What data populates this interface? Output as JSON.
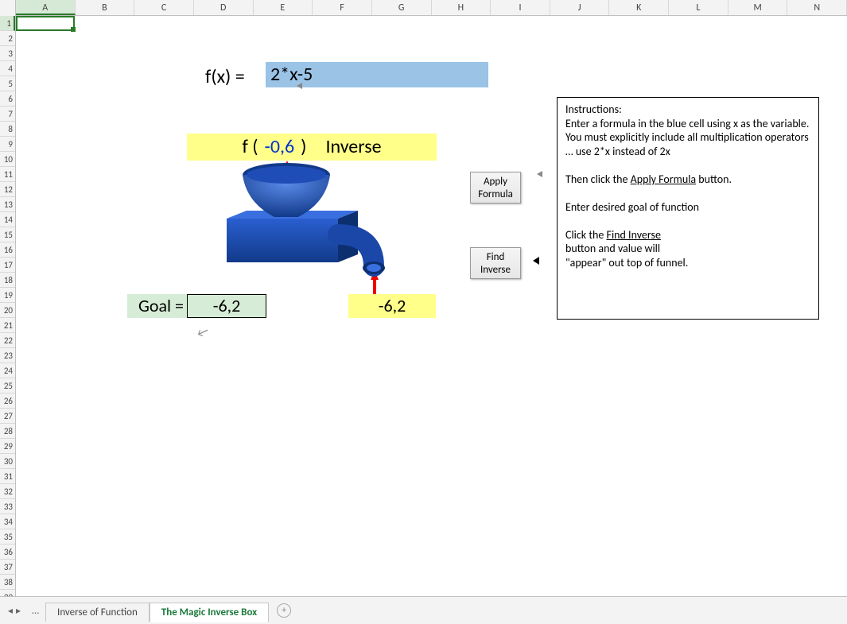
{
  "columns": [
    "A",
    "B",
    "C",
    "D",
    "E",
    "F",
    "G",
    "H",
    "I",
    "J",
    "K",
    "L",
    "M",
    "N"
  ],
  "selected_column_index": 0,
  "selected_row_index": 0,
  "fx": {
    "label": "f(x)  =",
    "formula": "2*x-5"
  },
  "inverse_bar": {
    "f_open": "f (",
    "value": "-0,6",
    "f_close": ")",
    "inverse_label": "Inverse"
  },
  "buttons": {
    "apply_line1": "Apply",
    "apply_line2": "Formula",
    "find_line1": "Find",
    "find_line2": "Inverse"
  },
  "goal": {
    "label": "Goal =",
    "value": "-6,2"
  },
  "output": {
    "value": "-6,2"
  },
  "instructions": {
    "l1": "Instructions:",
    "l2": "Enter a formula in the blue cell using x as the variable.  You must explicitly include all multiplication operators … use 2*x  instead of 2x",
    "l3a": "Then click the ",
    "l3u": "Apply Formula",
    "l3b": " button.",
    "l4": "Enter desired goal of function",
    "l5a": "Click the ",
    "l5u": "Find Inverse",
    "l6": " button and value will \"appear\" out top of funnel."
  },
  "tabs": {
    "t0": "Inverse of Function",
    "t1": "The Magic Inverse Box"
  }
}
